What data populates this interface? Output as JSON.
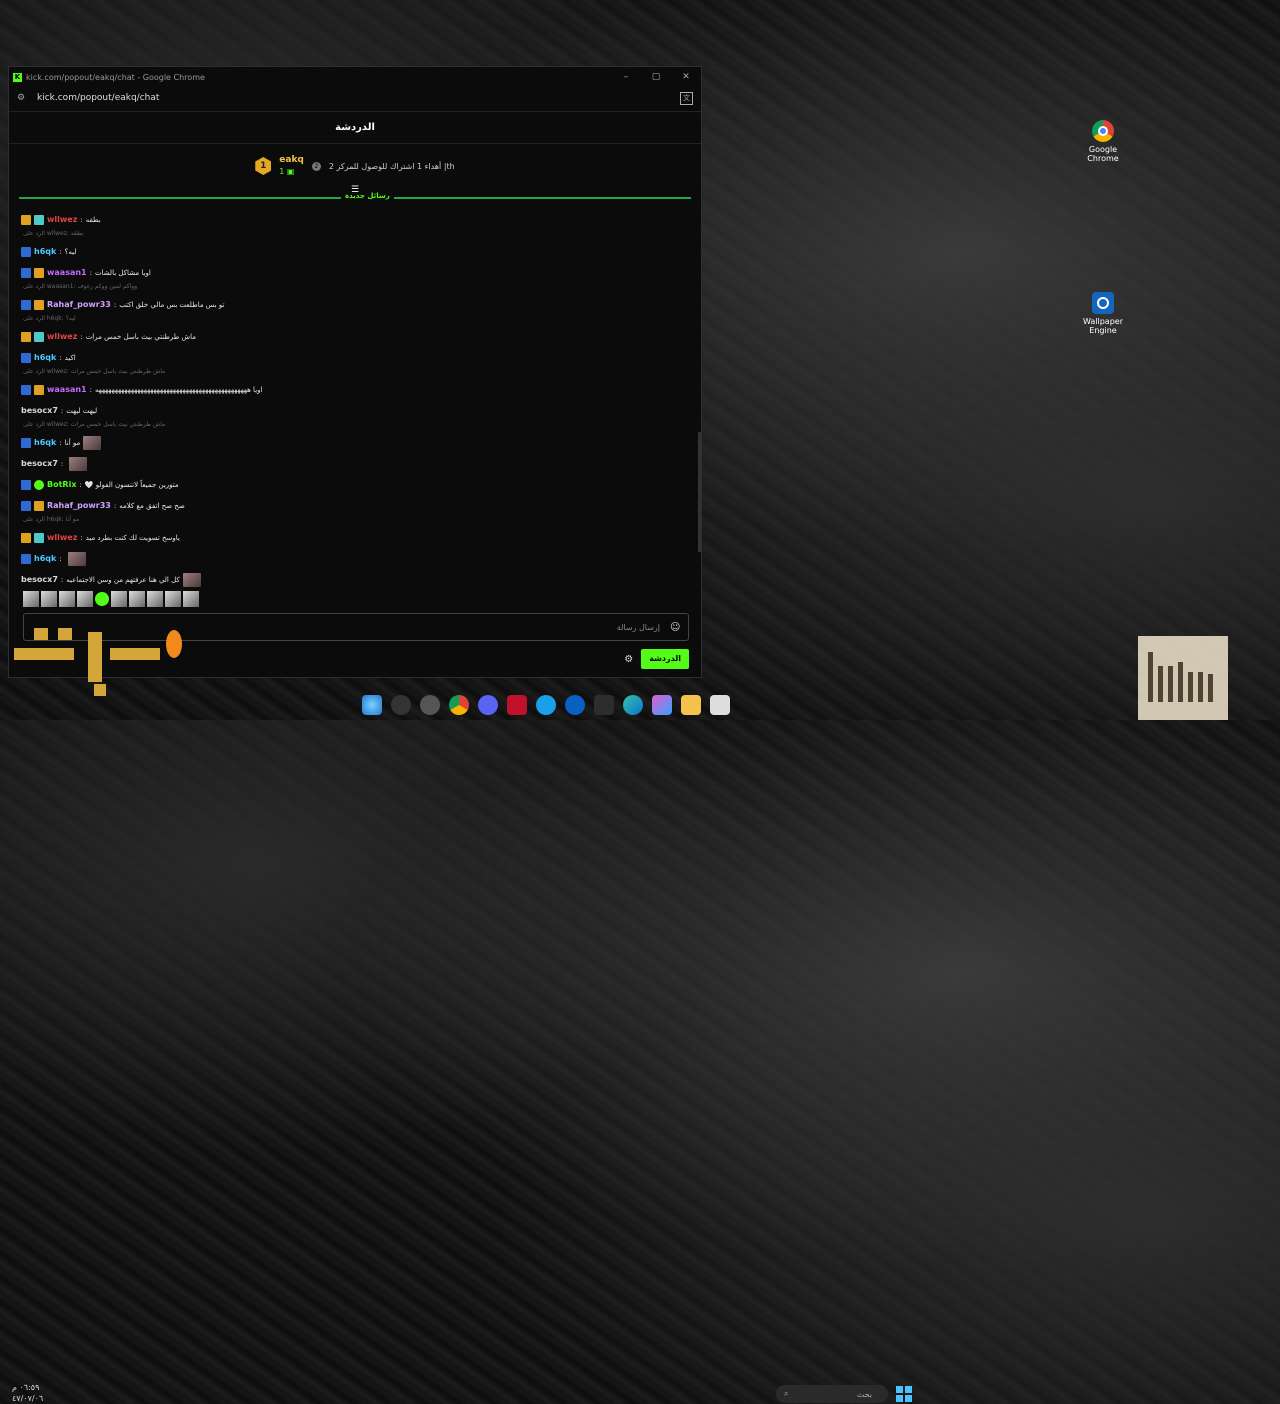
{
  "window": {
    "title": "kick.com/popout/eakq/chat - Google Chrome",
    "url": "kick.com/popout/eakq/chat",
    "controls": [
      "–",
      "▢",
      "✕"
    ]
  },
  "chat": {
    "header_title": "الدردشة",
    "pinned": {
      "badge_num": "1",
      "username": "eakq",
      "sub_count": "1",
      "rank_num": "2",
      "text": "أهداء 1 اشتراك للوصول للمركز 2 |th"
    },
    "new_messages_label": "رسائل جديدة",
    "messages": [
      {
        "type": "msg",
        "badges": [
          "gold",
          "teal"
        ],
        "user": "wllwez",
        "color": "#e04545",
        "text": "بطقه"
      },
      {
        "type": "reply",
        "text": "الرد على wllwez: بطقه"
      },
      {
        "type": "msg",
        "badges": [
          "blue"
        ],
        "user": "h6qk",
        "color": "#4ec9ff",
        "text": "ليه؟"
      },
      {
        "type": "msg",
        "badges": [
          "blue",
          "crown"
        ],
        "user": "waasan1",
        "color": "#c46bff",
        "text": "اويا مشاكل بالشات"
      },
      {
        "type": "reply",
        "text": "الرد على waasan1: وواكم لمين ووكم رغوف"
      },
      {
        "type": "msg",
        "badges": [
          "blue",
          "crown"
        ],
        "user": "Rahaf_powr33",
        "color": "#d0a0ff",
        "text": "تو بس ماطلعت بس مالي خلق اكتب"
      },
      {
        "type": "reply",
        "text": "الرد على h6qk: ليه؟"
      },
      {
        "type": "msg",
        "badges": [
          "gold",
          "teal"
        ],
        "user": "wllwez",
        "color": "#e04545",
        "text": "ماش طرطنتي بيث باسل خمس مرات"
      },
      {
        "type": "msg",
        "badges": [
          "blue"
        ],
        "user": "h6qk",
        "color": "#4ec9ff",
        "text": "اكيد"
      },
      {
        "type": "reply",
        "text": "الرد على wllwez: ماش طرطنتي بيث باسل خمس مرات"
      },
      {
        "type": "msg",
        "badges": [
          "blue",
          "crown"
        ],
        "user": "waasan1",
        "color": "#c46bff",
        "text": "اويا هههههههههههههههههههههههههههههههههههههههههههههههه"
      },
      {
        "type": "msg",
        "badges": [],
        "user": "besocx7",
        "color": "#d8d8d8",
        "text": "ليهت ليهت"
      },
      {
        "type": "reply",
        "text": "الرد على wllwez: ماش طرطنتي بيث باسل خمس مرات"
      },
      {
        "type": "msg",
        "badges": [
          "blue"
        ],
        "user": "h6qk",
        "color": "#4ec9ff",
        "text": "مو أنا",
        "emote": true
      },
      {
        "type": "msg",
        "badges": [],
        "user": "besocx7",
        "color": "#d8d8d8",
        "text": "",
        "emote": true
      },
      {
        "type": "msg",
        "badges": [
          "blue",
          "green"
        ],
        "user": "BotRix",
        "color": "#53fc18",
        "text": "🤍 متورين جميعاً لاتنسون الفولو"
      },
      {
        "type": "msg",
        "badges": [
          "blue",
          "crown"
        ],
        "user": "Rahaf_powr33",
        "color": "#d0a0ff",
        "text": "صح صح اتفق مع كلامه"
      },
      {
        "type": "reply",
        "text": "الرد على h6qk: مو أنا"
      },
      {
        "type": "msg",
        "badges": [
          "gold",
          "teal"
        ],
        "user": "wllwez",
        "color": "#e04545",
        "text": "ياوسخ تسويت لك كنت بطرد ميد"
      },
      {
        "type": "msg",
        "badges": [
          "blue"
        ],
        "user": "h6qk",
        "color": "#4ec9ff",
        "text": "",
        "emote": true
      },
      {
        "type": "msg",
        "badges": [],
        "user": "besocx7",
        "color": "#d8d8d8",
        "text": "كل الي هنا عرفتهم من وسن الاجتماعيه",
        "emote": true
      }
    ],
    "input_placeholder": "إرسال رسالة",
    "chat_button": "الدردشة"
  },
  "desktop": {
    "icons": [
      {
        "name": "google-chrome-icon",
        "label": "Google Chrome"
      },
      {
        "name": "wallpaper-engine-icon",
        "label": "Wallpaper Engine"
      }
    ]
  },
  "taskbar": {
    "search_placeholder": "بحث",
    "time": "٠٦:٥٩ م",
    "date": "٤٧/٠٧/٠٦"
  },
  "colors": {
    "kick_green": "#53fc18",
    "background": "#0b0b0c"
  }
}
